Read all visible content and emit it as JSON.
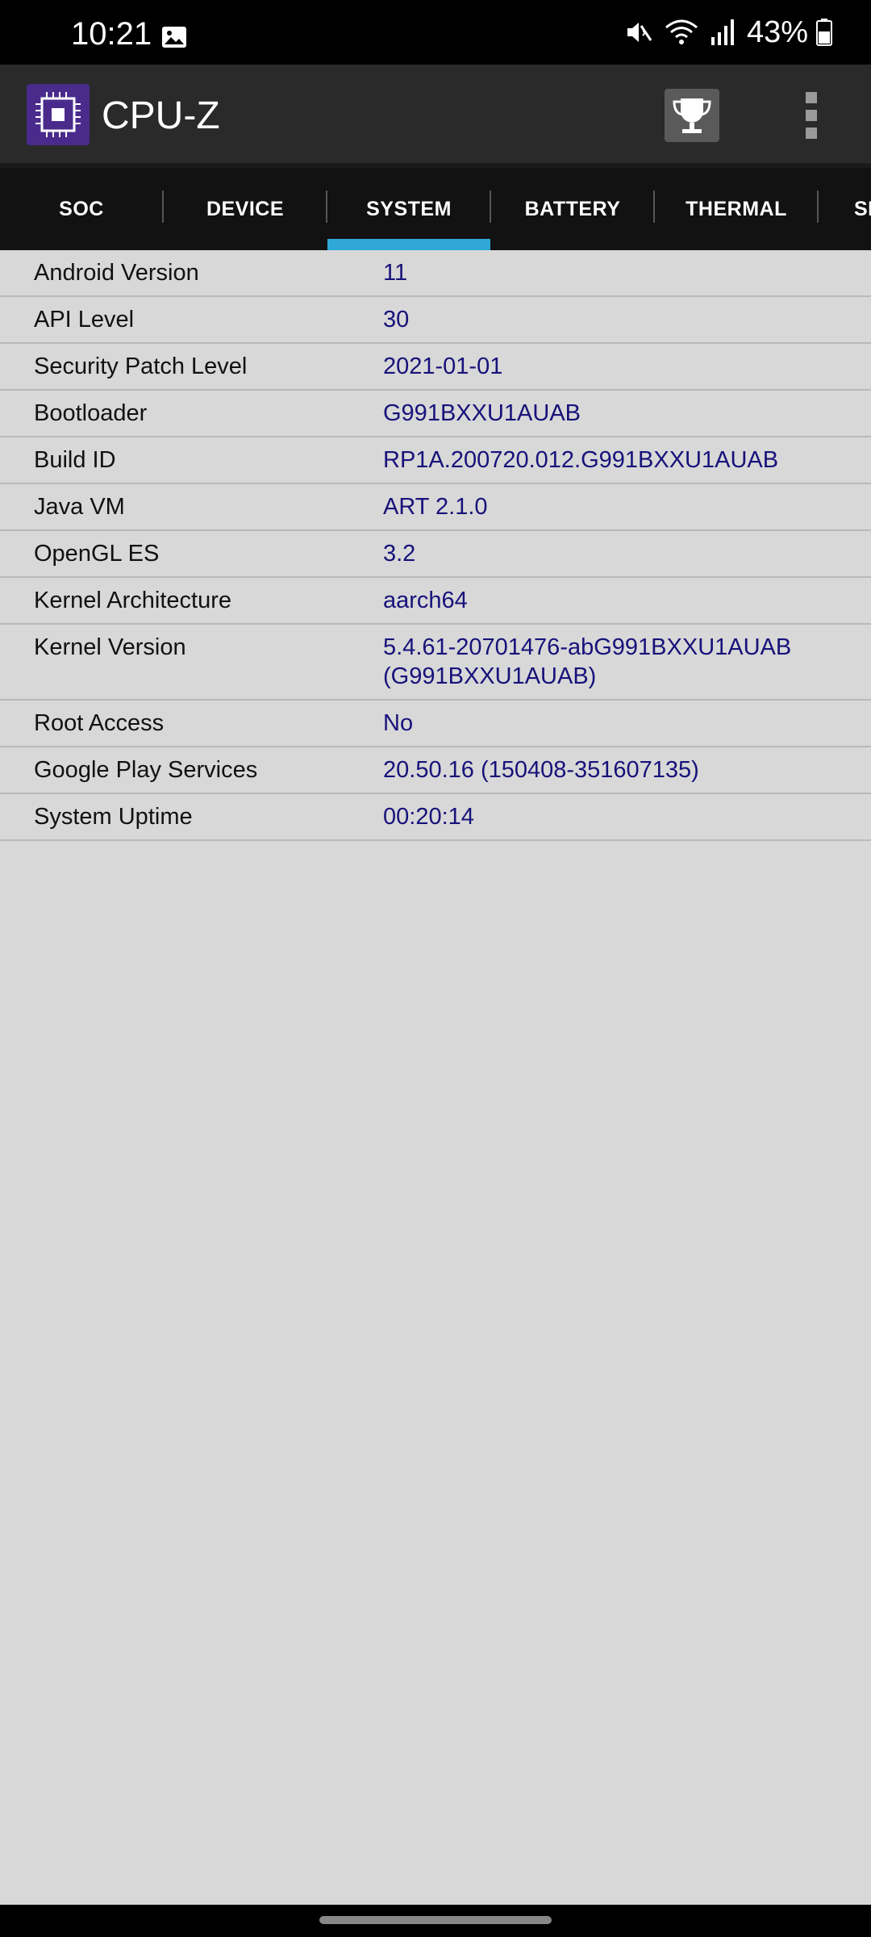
{
  "status_bar": {
    "time": "10:21",
    "battery_percent": "43%",
    "icons": [
      "gallery-icon",
      "mute-icon",
      "wifi-icon",
      "signal-icon",
      "battery-icon"
    ]
  },
  "app_bar": {
    "title": "CPU-Z",
    "logo_icon": "cpu-chip-icon",
    "actions": [
      "trophy-icon",
      "more-vert-icon"
    ]
  },
  "tabs": [
    {
      "label": "SOC"
    },
    {
      "label": "DEVICE"
    },
    {
      "label": "SYSTEM",
      "selected": true
    },
    {
      "label": "BATTERY"
    },
    {
      "label": "THERMAL"
    },
    {
      "label": "SE"
    }
  ],
  "rows": [
    {
      "label": "Android Version",
      "value": "11"
    },
    {
      "label": "API Level",
      "value": "30"
    },
    {
      "label": "Security Patch Level",
      "value": "2021-01-01"
    },
    {
      "label": "Bootloader",
      "value": "G991BXXU1AUAB"
    },
    {
      "label": "Build ID",
      "value": "RP1A.200720.012.G991BXXU1AUAB"
    },
    {
      "label": "Java VM",
      "value": "ART 2.1.0"
    },
    {
      "label": "OpenGL ES",
      "value": "3.2"
    },
    {
      "label": "Kernel Architecture",
      "value": "aarch64"
    },
    {
      "label": "Kernel Version",
      "value": "5.4.61-20701476-abG991BXXU1AUAB\n(G991BXXU1AUAB)"
    },
    {
      "label": "Root Access",
      "value": "No"
    },
    {
      "label": "Google Play Services",
      "value": "20.50.16 (150408-351607135)"
    },
    {
      "label": "System Uptime",
      "value": "00:20:14"
    }
  ],
  "colors": {
    "tab_indicator": "#2fa8d8",
    "value_text": "#17127a",
    "background": "#d8d8d8",
    "logo_bg": "#4a2b8c"
  }
}
